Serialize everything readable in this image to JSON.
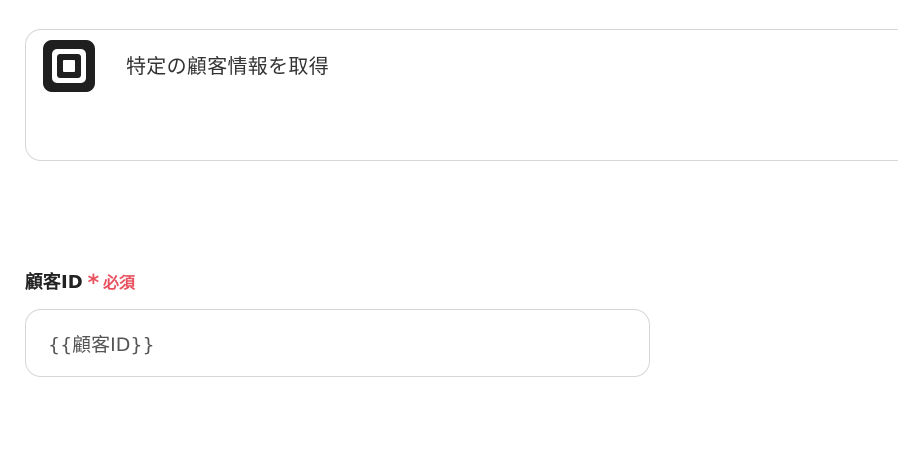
{
  "action": {
    "app_icon": "square-logo-icon",
    "title": "特定の顧客情報を取得"
  },
  "fields": [
    {
      "label": "顧客ID",
      "required_mark": "*",
      "required_text": "必須",
      "value": "{{顧客ID}}"
    }
  ],
  "colors": {
    "required": "#e8515f",
    "border": "#d6d6d6",
    "logo": "#1f1f1f"
  }
}
